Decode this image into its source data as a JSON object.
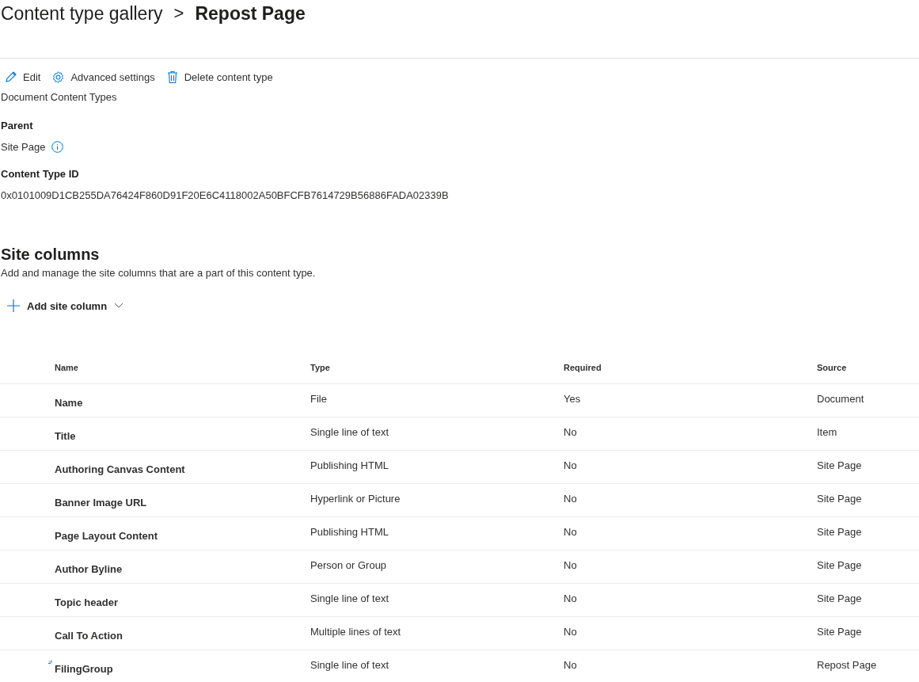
{
  "breadcrumb": {
    "parent": "Content type gallery",
    "separator": ">",
    "current": "Repost Page"
  },
  "commands": [
    {
      "kind": "edit",
      "label": "Edit"
    },
    {
      "kind": "settings",
      "label": "Advanced settings"
    },
    {
      "kind": "delete",
      "label": "Delete content type"
    }
  ],
  "group": "Document Content Types",
  "parent": {
    "label": "Parent",
    "value": "Site Page"
  },
  "content_type_id": {
    "label": "Content Type ID",
    "value": "0x0101009D1CB255DA76424F860D91F20E6C4118002A50BFCFB7614729B56886FADA02339B"
  },
  "site_columns": {
    "title": "Site columns",
    "description": "Add and manage the site columns that are a part of this content type.",
    "add_button": "Add site column"
  },
  "table": {
    "columns": [
      "Name",
      "Type",
      "Required",
      "Source"
    ],
    "rows": [
      {
        "name": "Name",
        "type": "File",
        "required": "Yes",
        "source": "Document",
        "new": false
      },
      {
        "name": "Title",
        "type": "Single line of text",
        "required": "No",
        "source": "Item",
        "new": false
      },
      {
        "name": "Authoring Canvas Content",
        "type": "Publishing HTML",
        "required": "No",
        "source": "Site Page",
        "new": false
      },
      {
        "name": "Banner Image URL",
        "type": "Hyperlink or Picture",
        "required": "No",
        "source": "Site Page",
        "new": false
      },
      {
        "name": "Page Layout Content",
        "type": "Publishing HTML",
        "required": "No",
        "source": "Site Page",
        "new": false
      },
      {
        "name": "Author Byline",
        "type": "Person or Group",
        "required": "No",
        "source": "Site Page",
        "new": false
      },
      {
        "name": "Topic header",
        "type": "Single line of text",
        "required": "No",
        "source": "Site Page",
        "new": false
      },
      {
        "name": "Call To Action",
        "type": "Multiple lines of text",
        "required": "No",
        "source": "Site Page",
        "new": false
      },
      {
        "name": "FilingGroup",
        "type": "Single line of text",
        "required": "No",
        "source": "Repost Page",
        "new": true
      }
    ]
  }
}
